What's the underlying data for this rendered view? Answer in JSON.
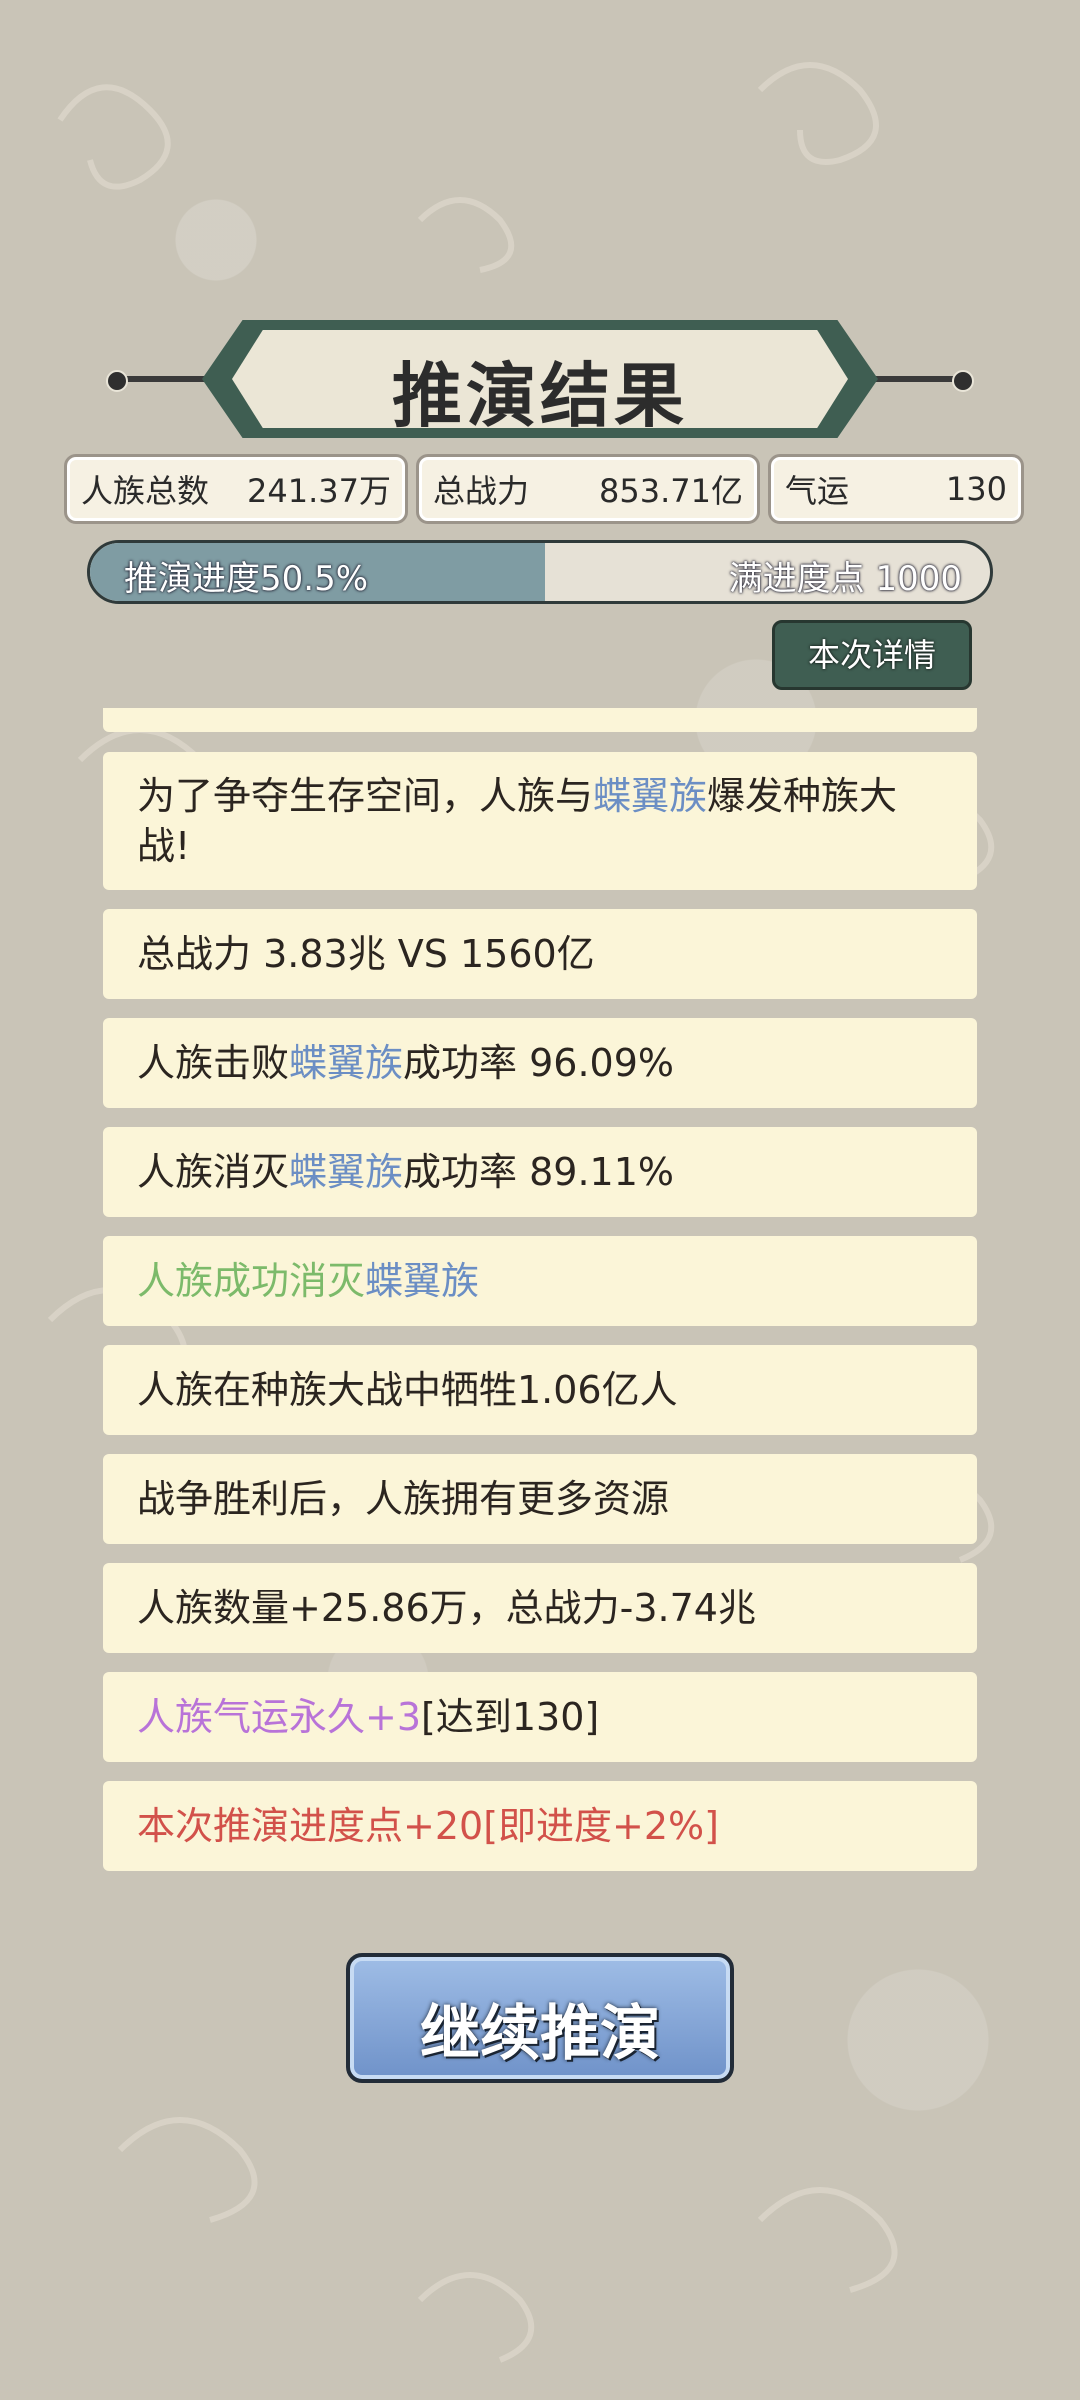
{
  "title": "推演结果",
  "stats": [
    {
      "label": "人族总数",
      "value": "241.37万"
    },
    {
      "label": "总战力",
      "value": "853.71亿"
    },
    {
      "label": "气运",
      "value": "130"
    }
  ],
  "progress": {
    "label": "推演进度50.5%",
    "fraction": 0.505,
    "right_label": "满进度点 1000"
  },
  "details_button": "本次详情",
  "events": [
    {
      "parts": [
        {
          "text": "为了争夺生存空间，人族与"
        },
        {
          "text": "蝶翼族",
          "color": "blue"
        },
        {
          "text": "爆发种族大战!"
        }
      ]
    },
    {
      "parts": [
        {
          "text": "总战力 3.83兆 VS 1560亿"
        }
      ]
    },
    {
      "parts": [
        {
          "text": "人族击败"
        },
        {
          "text": "蝶翼族",
          "color": "blue"
        },
        {
          "text": "成功率 96.09%"
        }
      ]
    },
    {
      "parts": [
        {
          "text": "人族消灭"
        },
        {
          "text": "蝶翼族",
          "color": "blue"
        },
        {
          "text": "成功率 89.11%"
        }
      ]
    },
    {
      "parts": [
        {
          "text": "人族成功消灭",
          "color": "green"
        },
        {
          "text": "蝶翼族",
          "color": "blue"
        }
      ]
    },
    {
      "parts": [
        {
          "text": "人族在种族大战中牺牲1.06亿人"
        }
      ]
    },
    {
      "parts": [
        {
          "text": "战争胜利后，人族拥有更多资源"
        }
      ]
    },
    {
      "parts": [
        {
          "text": "人族数量+25.86万，总战力-3.74兆"
        }
      ]
    },
    {
      "parts": [
        {
          "text": "人族气运永久+3",
          "color": "purple"
        },
        {
          "text": "[达到130]"
        }
      ]
    },
    {
      "parts": [
        {
          "text": "本次推演进度点+20[即进度+2%]",
          "color": "red"
        }
      ]
    }
  ],
  "continue_button": "继续推演"
}
